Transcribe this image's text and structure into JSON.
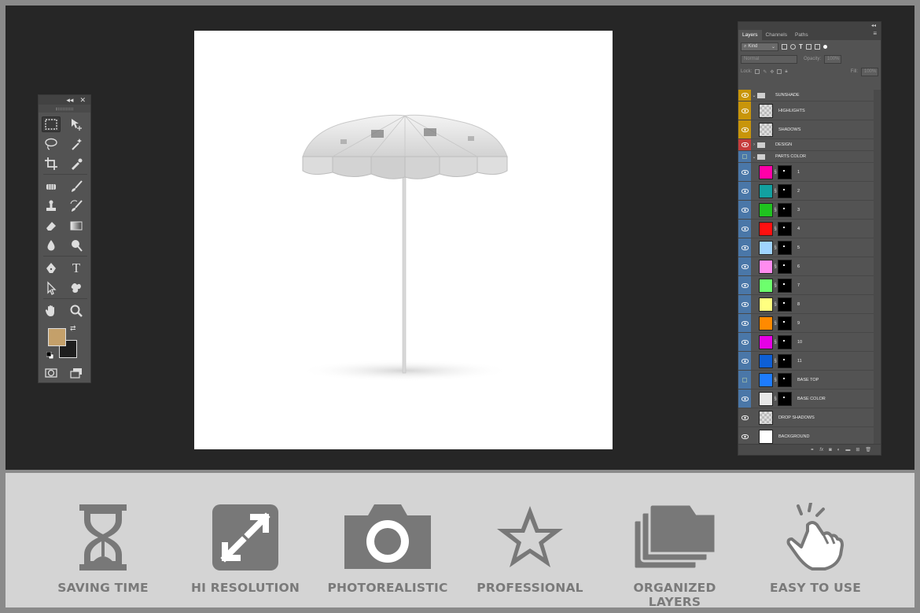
{
  "tools_panel": {
    "collapse_label": "◂◂",
    "close_label": "✕",
    "tools": [
      {
        "name": "rectangular-marquee-tool-icon"
      },
      {
        "name": "move-tool-icon"
      },
      {
        "name": "lasso-tool-icon"
      },
      {
        "name": "magic-wand-tool-icon"
      },
      {
        "name": "crop-tool-icon"
      },
      {
        "name": "eyedropper-tool-icon"
      },
      {
        "name": "spot-healing-brush-icon"
      },
      {
        "name": "brush-tool-icon"
      },
      {
        "name": "clone-stamp-icon"
      },
      {
        "name": "history-brush-icon"
      },
      {
        "name": "eraser-tool-icon"
      },
      {
        "name": "gradient-tool-icon"
      },
      {
        "name": "blur-tool-icon"
      },
      {
        "name": "dodge-tool-icon"
      },
      {
        "name": "pen-tool-icon"
      },
      {
        "name": "type-tool-icon"
      },
      {
        "name": "path-selection-icon"
      },
      {
        "name": "custom-shape-icon"
      },
      {
        "name": "hand-tool-icon"
      },
      {
        "name": "zoom-tool-icon"
      }
    ],
    "text_tool_glyph": "T",
    "foreground_color": "#c4a06a",
    "background_color": "#1e1e1e"
  },
  "layers_panel": {
    "collapse_label": "◂◂",
    "close_label": "✕",
    "tabs": [
      "Layers",
      "Channels",
      "Paths"
    ],
    "active_tab": "Layers",
    "filter_kind": "Kind",
    "blend_mode": "Normal",
    "opacity_label": "Opacity:",
    "opacity_value": "100%",
    "lock_label": "Lock:",
    "fill_label": "Fill:",
    "fill_value": "100%",
    "layers": [
      {
        "name": "SUNSHADE",
        "type": "group",
        "eye": "#c8950a",
        "visible": true
      },
      {
        "name": "HIGHLIGHTS",
        "type": "layer",
        "eye": "#c8950a",
        "visible": true,
        "thumb": "check"
      },
      {
        "name": "SHADOWS",
        "type": "layer",
        "eye": "#c8950a",
        "visible": true,
        "thumb": "check"
      },
      {
        "name": "DESIGN",
        "type": "group",
        "eye": "#c63c3c",
        "visible": true
      },
      {
        "name": "PARTS COLOR",
        "type": "group",
        "eye": "#4a77a8",
        "visible": false
      },
      {
        "name": "1",
        "type": "layer",
        "eye": "#4a77a8",
        "visible": true,
        "thumb": "#ff00a8",
        "mask": true
      },
      {
        "name": "2",
        "type": "layer",
        "eye": "#4a77a8",
        "visible": true,
        "thumb": "#12a0a0",
        "mask": true
      },
      {
        "name": "3",
        "type": "layer",
        "eye": "#4a77a8",
        "visible": true,
        "thumb": "#1fc31f",
        "mask": true
      },
      {
        "name": "4",
        "type": "layer",
        "eye": "#4a77a8",
        "visible": true,
        "thumb": "#ff1010",
        "mask": true
      },
      {
        "name": "5",
        "type": "layer",
        "eye": "#4a77a8",
        "visible": true,
        "thumb": "#9fd4ff",
        "mask": true
      },
      {
        "name": "6",
        "type": "layer",
        "eye": "#4a77a8",
        "visible": true,
        "thumb": "#ff8cf0",
        "mask": true
      },
      {
        "name": "7",
        "type": "layer",
        "eye": "#4a77a8",
        "visible": true,
        "thumb": "#6dff6d",
        "mask": true
      },
      {
        "name": "8",
        "type": "layer",
        "eye": "#4a77a8",
        "visible": true,
        "thumb": "#ffff80",
        "mask": true
      },
      {
        "name": "9",
        "type": "layer",
        "eye": "#4a77a8",
        "visible": true,
        "thumb": "#ff8a00",
        "mask": true
      },
      {
        "name": "10",
        "type": "layer",
        "eye": "#4a77a8",
        "visible": true,
        "thumb": "#e600e6",
        "mask": true
      },
      {
        "name": "11",
        "type": "layer",
        "eye": "#4a77a8",
        "visible": true,
        "thumb": "#0e5fd6",
        "mask": true
      },
      {
        "name": "BASE TOP",
        "type": "layer",
        "eye": "#4a77a8",
        "visible": false,
        "thumb": "#1e7cff",
        "mask": true
      },
      {
        "name": "BASE COLOR",
        "type": "layer",
        "eye": "#4a77a8",
        "visible": true,
        "thumb": "#e8e8e8",
        "mask": true
      },
      {
        "name": "DROP SHADOWS",
        "type": "layer",
        "eye": "#535353",
        "visible": true,
        "thumb": "check"
      },
      {
        "name": "BACKGROUND",
        "type": "layer",
        "eye": "#535353",
        "visible": true,
        "thumb": "#ffffff"
      }
    ],
    "footer_icons": [
      "link-icon",
      "fx-icon",
      "mask-icon",
      "adjustment-icon",
      "group-icon",
      "new-layer-icon",
      "trash-icon"
    ]
  },
  "features": [
    {
      "label": "SAVING TIME",
      "icon": "hourglass-icon"
    },
    {
      "label": "HI RESOLUTION",
      "icon": "expand-arrows-icon"
    },
    {
      "label": "PHOTOREALISTIC",
      "icon": "camera-icon"
    },
    {
      "label": "PROFESSIONAL",
      "icon": "star-icon"
    },
    {
      "label": "ORGANIZED LAYERS",
      "icon": "stacked-folders-icon"
    },
    {
      "label": "EASY TO USE",
      "icon": "pointing-hand-icon"
    }
  ],
  "colors": {
    "workspace": "#262626",
    "panel": "#535353",
    "feature_strip": "#d4d4d4",
    "feature_icon": "#787878"
  }
}
